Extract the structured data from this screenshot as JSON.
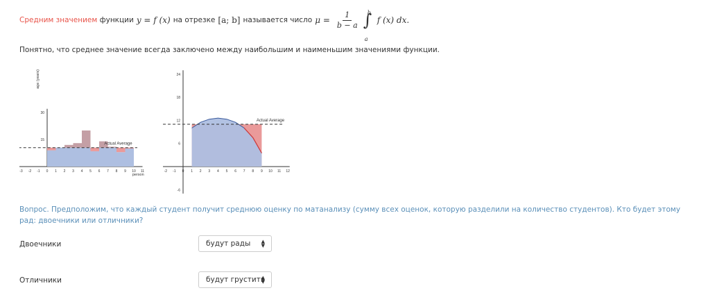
{
  "definition": {
    "highlight": "Средним значением",
    "text1": "функции",
    "func": "y = f (x)",
    "text2": "на отрезке",
    "segment": "[a; b]",
    "text3": "называется число",
    "mu": "μ =",
    "frac_num": "1",
    "frac_den": "b − a",
    "upper": "b",
    "lower": "a",
    "integrand": "f (x)  dx."
  },
  "note": "Понятно, что среднее значение всегда заключено между наибольшим и наименьшим значениями функции.",
  "chart_data": [
    {
      "type": "bar",
      "ylabel": "age (years)",
      "xlabel": "person",
      "x_ticks": [
        "-3",
        "-2",
        "-1",
        "0",
        "1",
        "2",
        "3",
        "4",
        "5",
        "6",
        "7",
        "8",
        "9",
        "10",
        "11"
      ],
      "y_ticks": [
        "15",
        "30"
      ],
      "bars": [
        {
          "x0": 0,
          "x1": 1,
          "value": 9,
          "above_avg": false
        },
        {
          "x0": 1,
          "x1": 2,
          "value": 11,
          "above_avg": false
        },
        {
          "x0": 2,
          "x1": 3,
          "value": 12,
          "above_avg": true
        },
        {
          "x0": 3,
          "x1": 4,
          "value": 13,
          "above_avg": true
        },
        {
          "x0": 4,
          "x1": 5,
          "value": 20,
          "above_avg": true
        },
        {
          "x0": 5,
          "x1": 6,
          "value": 8.5,
          "above_avg": false
        },
        {
          "x0": 6,
          "x1": 7,
          "value": 14,
          "above_avg": true
        },
        {
          "x0": 7,
          "x1": 8,
          "value": 11,
          "above_avg": true
        },
        {
          "x0": 8,
          "x1": 9,
          "value": 8,
          "above_avg": false
        },
        {
          "x0": 9,
          "x1": 10,
          "value": 10,
          "above_avg": false
        }
      ],
      "average": 10.5,
      "average_label": "Actual Average",
      "xlim": [
        -3,
        11
      ],
      "ylim": [
        0,
        30
      ]
    },
    {
      "type": "area",
      "x_ticks": [
        "-2",
        "-1",
        "0",
        "1",
        "2",
        "3",
        "4",
        "5",
        "6",
        "7",
        "8",
        "9",
        "10",
        "11",
        "12"
      ],
      "y_ticks": [
        "-6",
        "6",
        "12",
        "18",
        "24"
      ],
      "curve": {
        "x": [
          1,
          2,
          3,
          4,
          5,
          6,
          7,
          8,
          9
        ],
        "y": [
          10,
          11.5,
          12.3,
          12.6,
          12.3,
          11.5,
          10,
          7.5,
          3.5
        ]
      },
      "average": 11,
      "average_label": "Actual Average",
      "rect": {
        "x0": 1,
        "x1": 9,
        "value": 11
      },
      "xlim": [
        -2,
        12
      ],
      "ylim": [
        -6,
        24
      ]
    }
  ],
  "question": "Вопрос. Предположим, что каждый студент получит среднюю оценку по матанализу (сумму всех оценок, которую разделили на количество студентов). Кто будет этому рад: двоечники или отличники?",
  "rows": [
    {
      "label": "Двоечники",
      "selected": "будут рады"
    },
    {
      "label": "Отличники",
      "selected": "будут грустить"
    }
  ],
  "colors": {
    "blue_fill": "#aebfe1",
    "red_fill": "#ea9a9a",
    "overlap_fill": "#b5878f",
    "curve": "#3a5a9c",
    "curve_red": "#d33a3a"
  }
}
